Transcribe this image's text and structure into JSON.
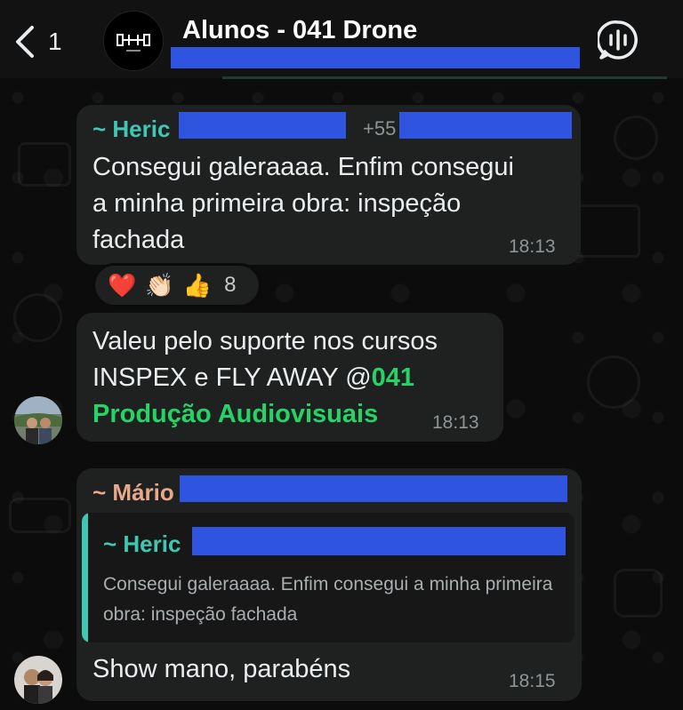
{
  "header": {
    "back_count": "1",
    "title": "Alunos - 041 Drone",
    "avatar_logo_text": "041"
  },
  "messages": [
    {
      "sender": "~ Heric",
      "phone_prefix": "+55",
      "text_lines": [
        "Consegui galeraaaa. Enfim consegui",
        "a minha primeira obra: inspeção",
        "fachada"
      ],
      "time": "18:13",
      "reactions": {
        "emojis": [
          "❤️",
          "👏🏻",
          "👍"
        ],
        "count": "8"
      }
    },
    {
      "line1": "Valeu pelo suporte nos cursos",
      "line2_prefix": "INSPEX e FLY AWAY @",
      "mention_a": "041",
      "mention_b": "Produção Audiovisuais",
      "time": "18:13"
    },
    {
      "sender": "~ Mário",
      "quoted_sender": "~ Heric",
      "quoted_text": "Consegui galeraaaa. Enfim consegui a minha primeira obra: inspeção fachada",
      "text": "Show mano, parabéns",
      "time": "18:15"
    }
  ],
  "colors": {
    "accent_teal": "#3ec7b2",
    "mention_green": "#25d366",
    "sender_peach": "#e7a98a",
    "redaction_blue": "#2f55e0",
    "bubble": "#1f2020"
  }
}
